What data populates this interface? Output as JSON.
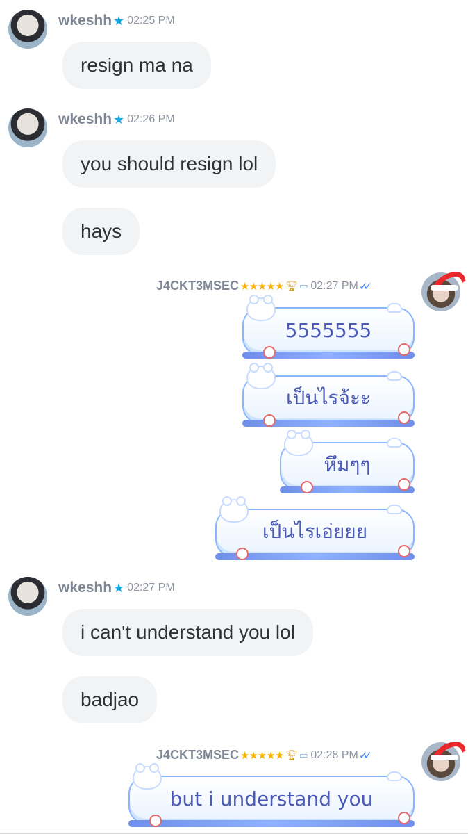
{
  "messages": [
    {
      "user": "wkeshh",
      "time": "02:25 PM",
      "texts": [
        "resign ma na"
      ]
    },
    {
      "user": "wkeshh",
      "time": "02:26 PM",
      "texts": [
        "you should resign lol",
        "hays"
      ]
    },
    {
      "user": "J4CKT3MSEC",
      "time": "02:27 PM",
      "texts": [
        "5555555",
        "เป็นไรจ้ะะ",
        "หึมๆๆ",
        "เป็นไรเอ่ยยย"
      ]
    },
    {
      "user": "wkeshh",
      "time": "02:27 PM",
      "texts": [
        "i can't understand you lol",
        "badjao"
      ]
    },
    {
      "user": "J4CKT3MSEC",
      "time": "02:28 PM",
      "texts": [
        "but i understand you"
      ]
    }
  ],
  "icons": {
    "verified": "star-badge-icon",
    "rank": "five-stars-icon",
    "trophy": "trophy-icon",
    "book": "book-icon",
    "read": "double-check-icon"
  },
  "colors": {
    "bubble_left": "#f2f3f5",
    "bubble_right_text": "#4a5ab6",
    "read_checks": "#3b82f6",
    "verified_star": "#1aa7e8",
    "rank_stars": "#f4b400"
  }
}
